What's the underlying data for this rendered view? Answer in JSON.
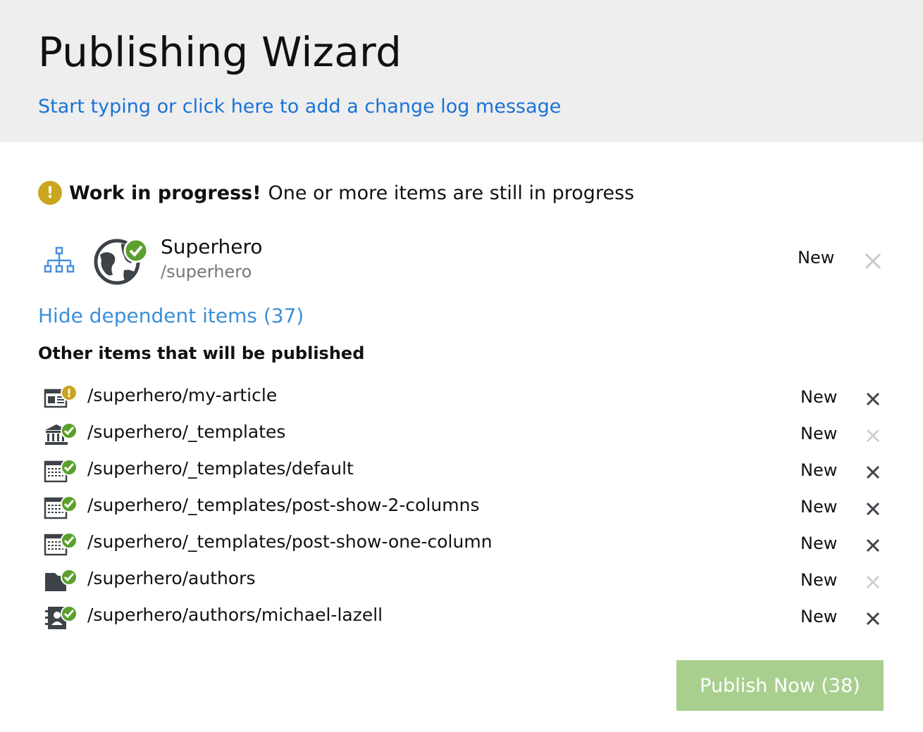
{
  "header": {
    "title": "Publishing Wizard",
    "changelog_placeholder": "Start typing or click here to add a change log message"
  },
  "warning": {
    "icon": "exclamation-icon",
    "title": "Work in progress!",
    "message": "One or more items are still in progress"
  },
  "main_item": {
    "name": "Superhero",
    "path": "/superhero",
    "status": "New",
    "icons": [
      "sitemap-icon",
      "globe-icon",
      "check-badge-icon"
    ]
  },
  "dependent_toggle": "Hide dependent items (37)",
  "section_heading": "Other items that will be published",
  "dependent_items": [
    {
      "path": "/superhero/my-article",
      "status": "New",
      "icon": "article-icon",
      "badge": "warning",
      "removable": true
    },
    {
      "path": "/superhero/_templates",
      "status": "New",
      "icon": "templates-library-icon",
      "badge": "ok",
      "removable": false
    },
    {
      "path": "/superhero/_templates/default",
      "status": "New",
      "icon": "template-icon",
      "badge": "ok",
      "removable": true
    },
    {
      "path": "/superhero/_templates/post-show-2-columns",
      "status": "New",
      "icon": "template-icon",
      "badge": "ok",
      "removable": true
    },
    {
      "path": "/superhero/_templates/post-show-one-column",
      "status": "New",
      "icon": "template-icon",
      "badge": "ok",
      "removable": true
    },
    {
      "path": "/superhero/authors",
      "status": "New",
      "icon": "folder-icon",
      "badge": "ok",
      "removable": false
    },
    {
      "path": "/superhero/authors/michael-lazell",
      "status": "New",
      "icon": "author-profile-icon",
      "badge": "ok",
      "removable": true
    }
  ],
  "publish_button": "Publish Now (38)",
  "colors": {
    "link": "#1a73d6",
    "warning": "#c9a520",
    "ok": "#5aa02c",
    "publish_disabled": "#a9cf8f",
    "header_bg": "#eeeeee"
  }
}
